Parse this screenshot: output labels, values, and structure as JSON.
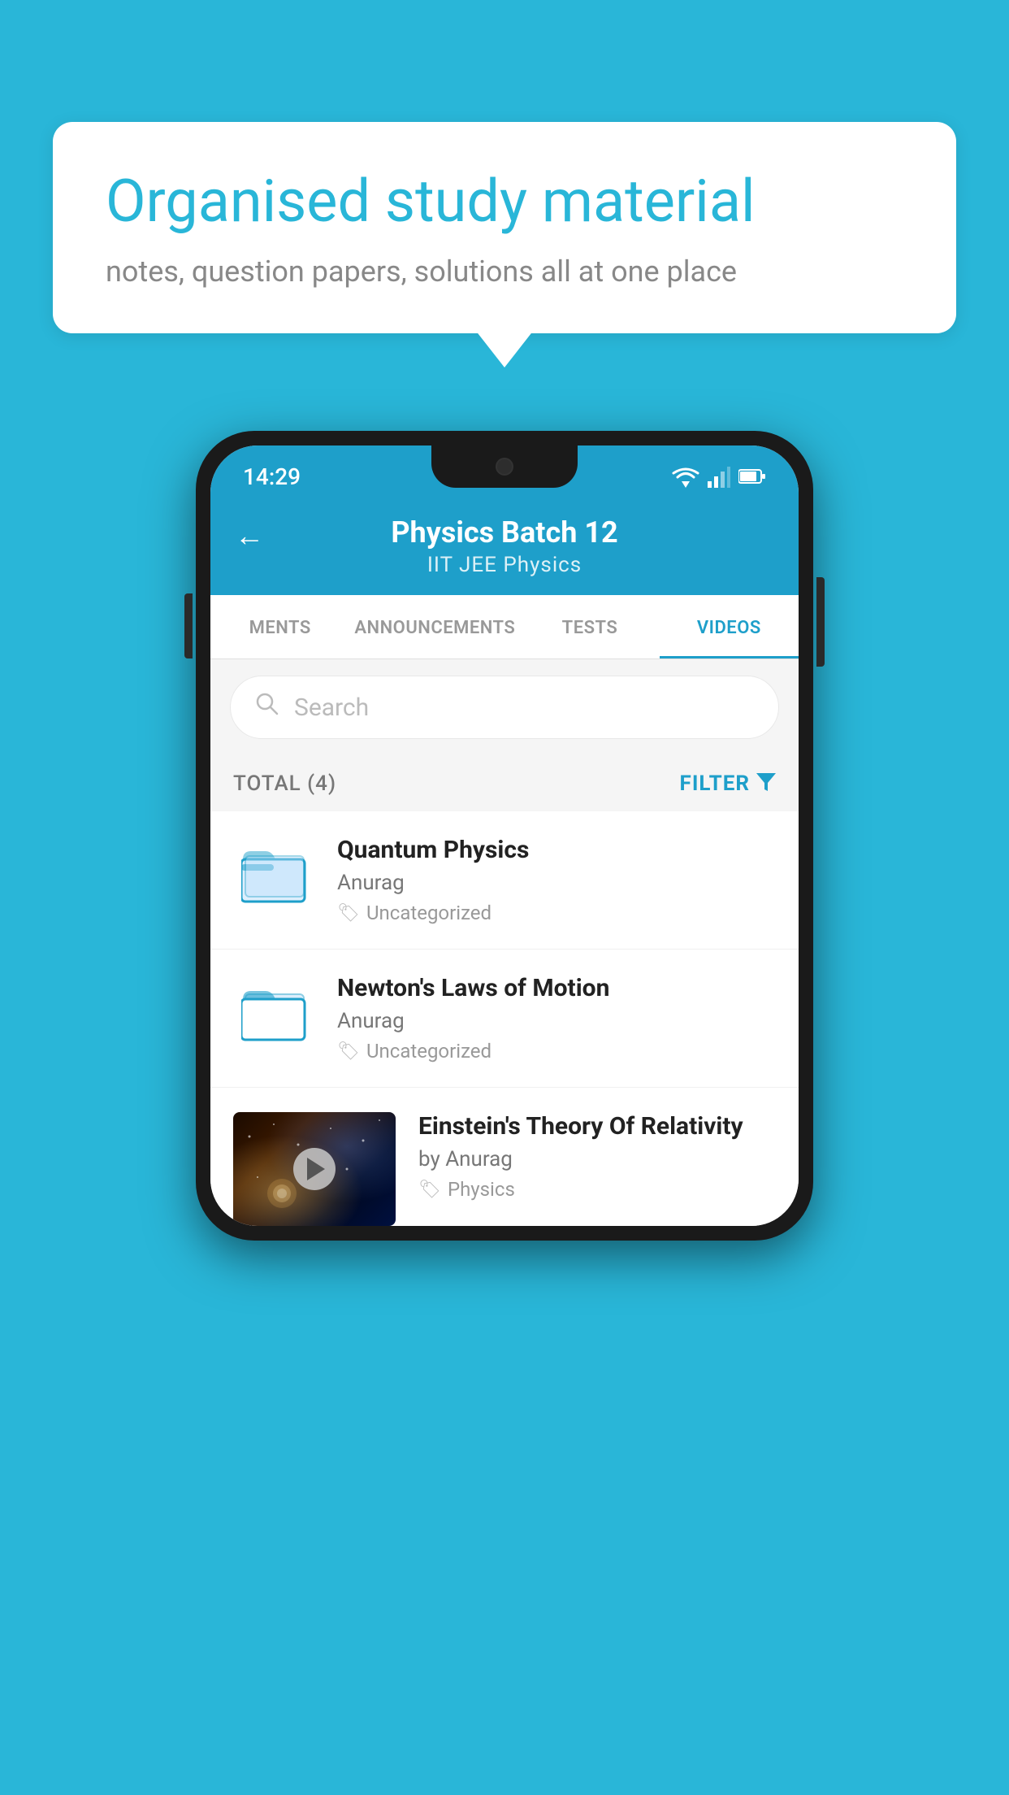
{
  "background": {
    "color": "#29b6d8"
  },
  "speech_bubble": {
    "title": "Organised study material",
    "subtitle": "notes, question papers, solutions all at one place"
  },
  "phone": {
    "status_bar": {
      "time": "14:29"
    },
    "header": {
      "back_label": "←",
      "title": "Physics Batch 12",
      "subtitle": "IIT JEE    Physics"
    },
    "tabs": [
      {
        "label": "MENTS",
        "active": false
      },
      {
        "label": "ANNOUNCEMENTS",
        "active": false
      },
      {
        "label": "TESTS",
        "active": false
      },
      {
        "label": "VIDEOS",
        "active": true
      }
    ],
    "search": {
      "placeholder": "Search"
    },
    "filter_bar": {
      "total": "TOTAL (4)",
      "filter_label": "FILTER"
    },
    "video_items": [
      {
        "title": "Quantum Physics",
        "author": "Anurag",
        "tag": "Uncategorized",
        "type": "folder"
      },
      {
        "title": "Newton's Laws of Motion",
        "author": "Anurag",
        "tag": "Uncategorized",
        "type": "folder"
      },
      {
        "title": "Einstein's Theory Of Relativity",
        "author": "by Anurag",
        "tag": "Physics",
        "type": "video"
      }
    ]
  }
}
